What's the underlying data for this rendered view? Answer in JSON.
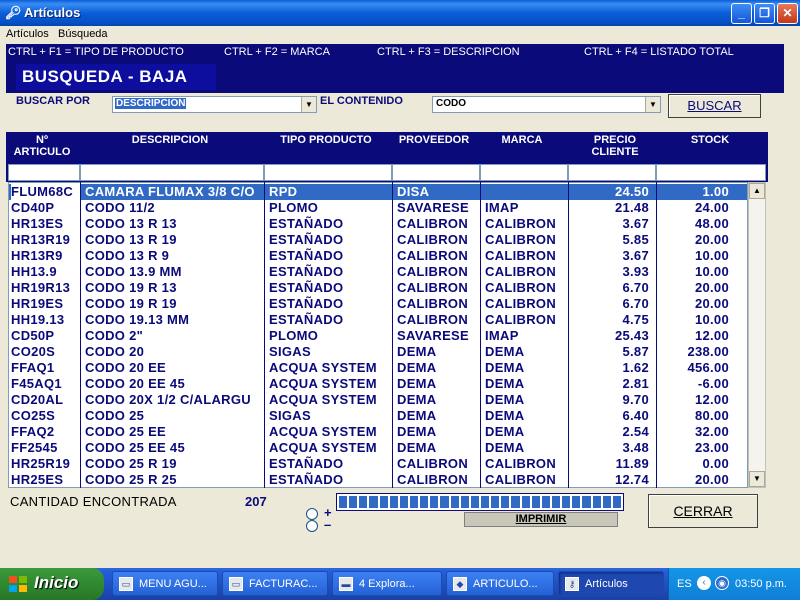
{
  "window": {
    "title": "Artículos"
  },
  "menu": [
    "Artículos",
    "Búsqueda"
  ],
  "shortcuts": [
    "CTRL + F1 = TIPO DE PRODUCTO",
    "CTRL + F2 = MARCA",
    "CTRL + F3 = DESCRIPCION",
    "CTRL + F4 = LISTADO TOTAL"
  ],
  "header": {
    "title": "BUSQUEDA - BAJA"
  },
  "search": {
    "buscar_por_label": "BUSCAR POR",
    "buscar_por_value": "DESCRIPCION",
    "contenido_label": "EL CONTENIDO",
    "contenido_value": "CODO",
    "buscar_button": "BUSCAR"
  },
  "table": {
    "columns": [
      {
        "label": "Nº ARTICULO"
      },
      {
        "label": "DESCRIPCION"
      },
      {
        "label": "TIPO PRODUCTO"
      },
      {
        "label": "PROVEEDOR"
      },
      {
        "label": "MARCA"
      },
      {
        "label": "PRECIO CLIENTE"
      },
      {
        "label": "STOCK"
      }
    ],
    "selected_row": 0,
    "rows": [
      [
        "FLUM68C",
        "CAMARA FLUMAX 3/8 C/O",
        "RPD",
        "DISA",
        "",
        "24.50",
        "1.00"
      ],
      [
        "CD40P",
        "CODO 11/2",
        "PLOMO",
        "SAVARESE",
        "IMAP",
        "21.48",
        "24.00"
      ],
      [
        "HR13ES",
        "CODO 13 R 13",
        "ESTAÑADO",
        "CALIBRON",
        "CALIBRON",
        "3.67",
        "48.00"
      ],
      [
        "HR13R19",
        "CODO 13 R 19",
        "ESTAÑADO",
        "CALIBRON",
        "CALIBRON",
        "5.85",
        "20.00"
      ],
      [
        "HR13R9",
        "CODO 13 R 9",
        "ESTAÑADO",
        "CALIBRON",
        "CALIBRON",
        "3.67",
        "10.00"
      ],
      [
        "HH13.9",
        "CODO 13.9 MM",
        "ESTAÑADO",
        "CALIBRON",
        "CALIBRON",
        "3.93",
        "10.00"
      ],
      [
        "HR19R13",
        "CODO 19 R 13",
        "ESTAÑADO",
        "CALIBRON",
        "CALIBRON",
        "6.70",
        "20.00"
      ],
      [
        "HR19ES",
        "CODO 19 R 19",
        "ESTAÑADO",
        "CALIBRON",
        "CALIBRON",
        "6.70",
        "20.00"
      ],
      [
        "HH19.13",
        "CODO 19.13 MM",
        "ESTAÑADO",
        "CALIBRON",
        "CALIBRON",
        "4.75",
        "10.00"
      ],
      [
        "CD50P",
        "CODO 2\"",
        "PLOMO",
        "SAVARESE",
        "IMAP",
        "25.43",
        "12.00"
      ],
      [
        "CO20S",
        "CODO 20",
        "SIGAS",
        "DEMA",
        "DEMA",
        "5.87",
        "238.00"
      ],
      [
        "FFAQ1",
        "CODO 20 EE",
        "ACQUA SYSTEM",
        "DEMA",
        "DEMA",
        "1.62",
        "456.00"
      ],
      [
        "F45AQ1",
        "CODO 20 EE 45",
        "ACQUA SYSTEM",
        "DEMA",
        "DEMA",
        "2.81",
        "-6.00"
      ],
      [
        "CD20AL",
        "CODO 20X 1/2 C/ALARGU",
        "ACQUA SYSTEM",
        "DEMA",
        "DEMA",
        "9.70",
        "12.00"
      ],
      [
        "CO25S",
        "CODO 25",
        "SIGAS",
        "DEMA",
        "DEMA",
        "6.40",
        "80.00"
      ],
      [
        "FFAQ2",
        "CODO 25 EE",
        "ACQUA SYSTEM",
        "DEMA",
        "DEMA",
        "2.54",
        "32.00"
      ],
      [
        "FF2545",
        "CODO 25 EE 45",
        "ACQUA SYSTEM",
        "DEMA",
        "DEMA",
        "3.48",
        "23.00"
      ],
      [
        "HR25R19",
        "CODO 25 R 19",
        "ESTAÑADO",
        "CALIBRON",
        "CALIBRON",
        "11.89",
        "0.00"
      ],
      [
        "HR25ES",
        "CODO 25 R 25",
        "ESTAÑADO",
        "CALIBRON",
        "CALIBRON",
        "12.74",
        "20.00"
      ]
    ]
  },
  "footer": {
    "count_label": "CANTIDAD ENCONTRADA",
    "count_value": "207",
    "radio_plus": "+",
    "radio_minus": "–",
    "imprimir_button": "IMPRIMIR",
    "cerrar_button": "CERRAR",
    "progress_fraction": 1.0
  },
  "taskbar": {
    "start_label": "Inicio",
    "tasks": [
      {
        "label": "MENU AGU...",
        "icon": "window-icon"
      },
      {
        "label": "FACTURAC...",
        "icon": "window-icon"
      },
      {
        "label": "4 Explora...",
        "icon": "folder-icon"
      },
      {
        "label": "ARTICULO...",
        "icon": "app-icon"
      },
      {
        "label": "Artículos",
        "icon": "key-icon",
        "active": true
      }
    ],
    "lang": "ES",
    "clock": "03:50 p.m."
  }
}
